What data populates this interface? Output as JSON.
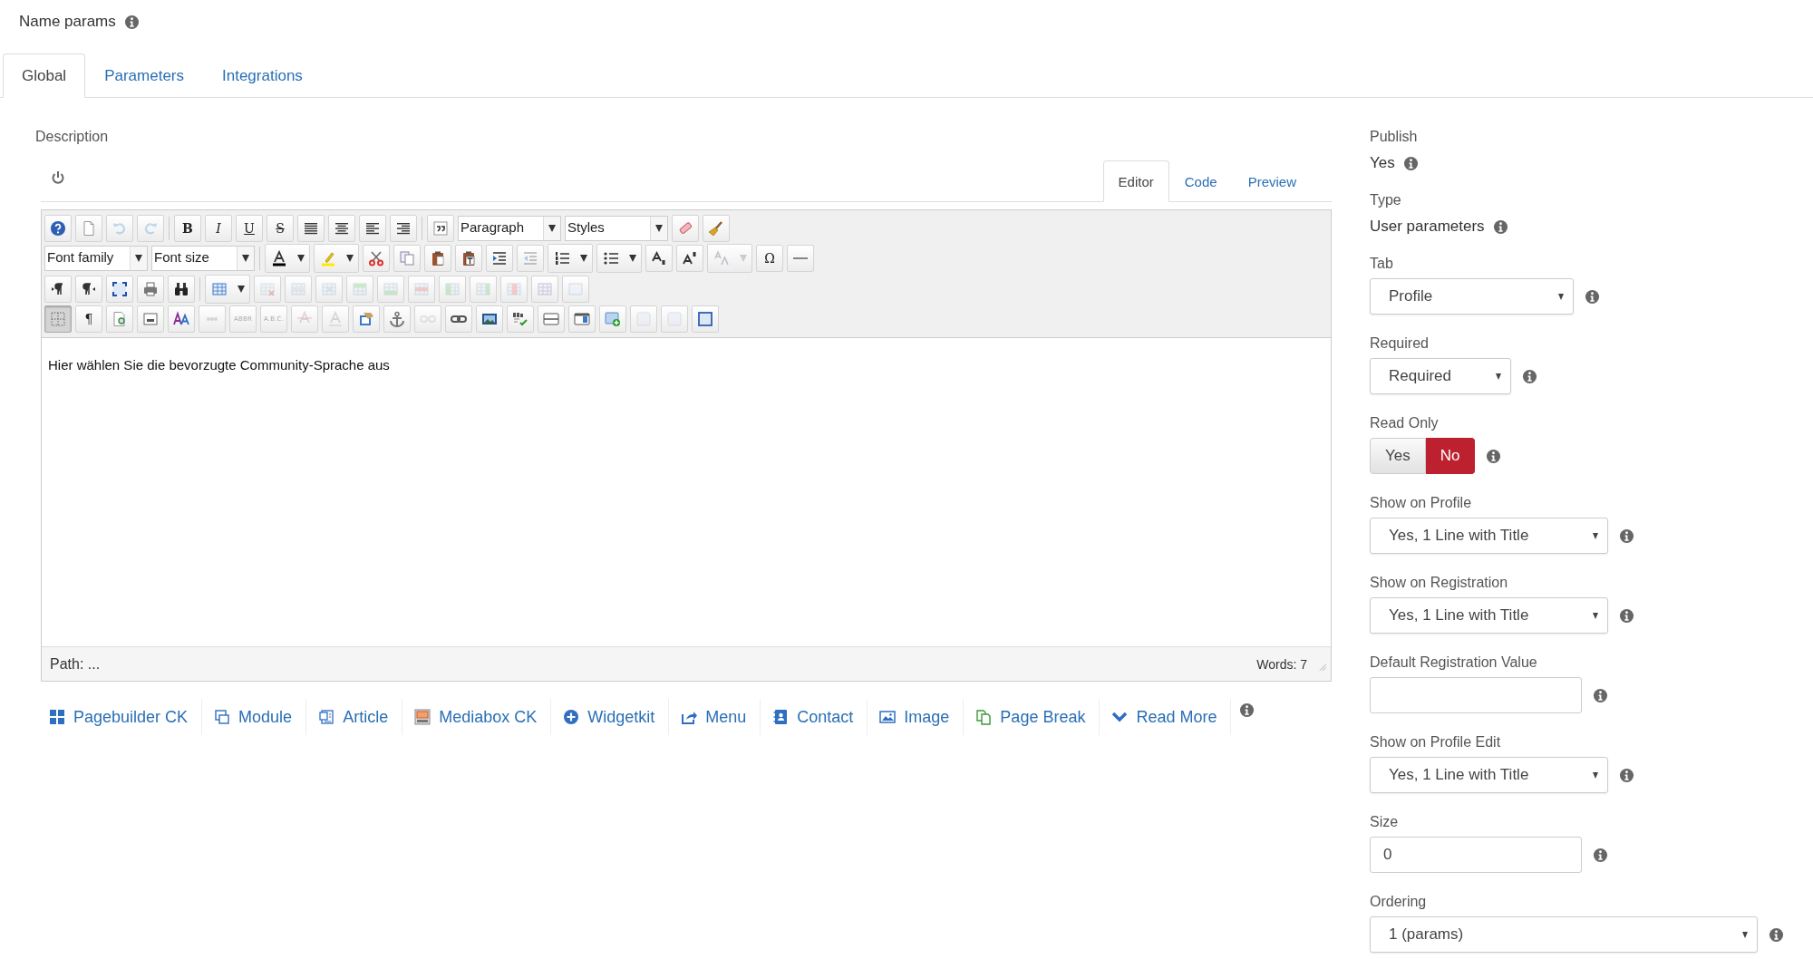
{
  "field_label": {
    "text": "Name params"
  },
  "tabs": [
    {
      "label": "Global",
      "selected": true
    },
    {
      "label": "Parameters",
      "selected": false
    },
    {
      "label": "Integrations",
      "selected": false
    }
  ],
  "description": {
    "label": "Description",
    "editor_tabs": [
      {
        "label": "Editor",
        "selected": true
      },
      {
        "label": "Code",
        "selected": false
      },
      {
        "label": "Preview",
        "selected": false
      }
    ],
    "toolbar": [
      [
        [
          {
            "kind": "icon",
            "disabled": false,
            "pressed": false
          },
          {
            "kind": "icon",
            "disabled": false,
            "pressed": false
          },
          {
            "kind": "icon",
            "disabled": true,
            "pressed": false
          },
          {
            "kind": "icon",
            "disabled": true,
            "pressed": false
          }
        ],
        [
          {
            "kind": "glyph",
            "text": "B",
            "disabled": false,
            "pressed": false
          },
          {
            "kind": "glyph",
            "text": "I",
            "disabled": false,
            "pressed": false
          },
          {
            "kind": "glyph",
            "text": "U",
            "disabled": false,
            "pressed": false
          },
          {
            "kind": "glyph",
            "text": "S",
            "disabled": false,
            "pressed": false
          },
          {
            "kind": "icon",
            "disabled": false,
            "pressed": false
          },
          {
            "kind": "icon",
            "disabled": false,
            "pressed": false
          },
          {
            "kind": "icon",
            "disabled": false,
            "pressed": false
          },
          {
            "kind": "icon",
            "disabled": false,
            "pressed": false
          }
        ],
        [
          {
            "kind": "icon",
            "disabled": false,
            "pressed": false
          },
          {
            "kind": "select",
            "text": "Paragraph",
            "disabled": false,
            "pressed": false
          },
          {
            "kind": "select",
            "text": "Styles",
            "disabled": false,
            "pressed": false
          },
          {
            "kind": "icon",
            "disabled": false,
            "pressed": false
          },
          {
            "kind": "icon",
            "disabled": false,
            "pressed": false
          }
        ]
      ],
      [
        [
          {
            "kind": "select",
            "text": "Font family",
            "disabled": false,
            "pressed": false
          },
          {
            "kind": "select",
            "text": "Font size",
            "disabled": false,
            "pressed": false
          }
        ],
        [
          {
            "kind": "split",
            "disabled": false,
            "pressed": false
          },
          {
            "kind": "split",
            "disabled": false,
            "pressed": false
          },
          {
            "kind": "icon",
            "disabled": false,
            "pressed": false
          },
          {
            "kind": "icon",
            "disabled": false,
            "pressed": false
          },
          {
            "kind": "icon",
            "disabled": false,
            "pressed": false
          },
          {
            "kind": "icon",
            "disabled": false,
            "pressed": false
          },
          {
            "kind": "icon",
            "disabled": false,
            "pressed": false
          },
          {
            "kind": "icon",
            "disabled": true,
            "pressed": false
          },
          {
            "kind": "split",
            "disabled": false,
            "pressed": false
          },
          {
            "kind": "split",
            "disabled": false,
            "pressed": false
          },
          {
            "kind": "icon",
            "disabled": false,
            "pressed": false
          },
          {
            "kind": "icon",
            "disabled": false,
            "pressed": false
          },
          {
            "kind": "split",
            "disabled": true,
            "pressed": false
          },
          {
            "kind": "glyph",
            "text": "Ω",
            "disabled": false,
            "pressed": false
          },
          {
            "kind": "icon",
            "disabled": false,
            "pressed": false
          }
        ]
      ],
      [
        [
          {
            "kind": "icon",
            "disabled": false,
            "pressed": false
          },
          {
            "kind": "icon",
            "disabled": false,
            "pressed": false
          },
          {
            "kind": "icon",
            "disabled": false,
            "pressed": false
          },
          {
            "kind": "icon",
            "disabled": false,
            "pressed": false
          },
          {
            "kind": "icon",
            "disabled": false,
            "pressed": false
          }
        ],
        [
          {
            "kind": "split",
            "disabled": false,
            "pressed": false
          },
          {
            "kind": "icon",
            "disabled": true,
            "pressed": false
          },
          {
            "kind": "icon",
            "disabled": true,
            "pressed": false
          },
          {
            "kind": "icon",
            "disabled": true,
            "pressed": false
          },
          {
            "kind": "icon",
            "disabled": true,
            "pressed": false
          },
          {
            "kind": "icon",
            "disabled": true,
            "pressed": false
          },
          {
            "kind": "icon",
            "disabled": true,
            "pressed": false
          },
          {
            "kind": "icon",
            "disabled": true,
            "pressed": false
          },
          {
            "kind": "icon",
            "disabled": true,
            "pressed": false
          },
          {
            "kind": "icon",
            "disabled": true,
            "pressed": false
          },
          {
            "kind": "icon",
            "disabled": true,
            "pressed": false
          },
          {
            "kind": "icon",
            "disabled": true,
            "pressed": false
          }
        ]
      ],
      [
        [
          {
            "kind": "icon",
            "disabled": false,
            "pressed": true
          },
          {
            "kind": "glyph",
            "text": "¶",
            "disabled": false,
            "pressed": false
          },
          {
            "kind": "icon",
            "disabled": false,
            "pressed": false
          },
          {
            "kind": "icon",
            "disabled": false,
            "pressed": false
          },
          {
            "kind": "icon",
            "disabled": false,
            "pressed": false
          },
          {
            "kind": "icon",
            "disabled": true,
            "pressed": false
          },
          {
            "kind": "glyph",
            "text": "ABBR",
            "disabled": true,
            "pressed": false
          },
          {
            "kind": "glyph",
            "text": "A.B.C.",
            "disabled": true,
            "pressed": false
          },
          {
            "kind": "icon",
            "disabled": true,
            "pressed": false
          },
          {
            "kind": "icon",
            "disabled": true,
            "pressed": false
          },
          {
            "kind": "icon",
            "disabled": false,
            "pressed": false
          },
          {
            "kind": "icon",
            "disabled": false,
            "pressed": false
          },
          {
            "kind": "icon",
            "disabled": true,
            "pressed": false
          },
          {
            "kind": "icon",
            "disabled": false,
            "pressed": false
          },
          {
            "kind": "icon",
            "disabled": false,
            "pressed": false
          },
          {
            "kind": "icon",
            "disabled": false,
            "pressed": false
          },
          {
            "kind": "icon",
            "disabled": false,
            "pressed": false
          },
          {
            "kind": "icon",
            "disabled": false,
            "pressed": false
          },
          {
            "kind": "icon",
            "disabled": false,
            "pressed": false
          },
          {
            "kind": "icon",
            "disabled": true,
            "pressed": false
          },
          {
            "kind": "icon",
            "disabled": true,
            "pressed": false
          },
          {
            "kind": "icon",
            "disabled": false,
            "pressed": false
          }
        ]
      ]
    ],
    "content": "Hier wählen Sie die bevorzugte Community-Sprache aus",
    "path": "Path: ...",
    "word_count": "Words: 7",
    "buttons": [
      {
        "label": "Pagebuilder CK"
      },
      {
        "label": "Module"
      },
      {
        "label": "Article"
      },
      {
        "label": "Mediabox CK"
      },
      {
        "label": "Widgetkit"
      },
      {
        "label": "Menu"
      },
      {
        "label": "Contact"
      },
      {
        "label": "Image"
      },
      {
        "label": "Page Break"
      },
      {
        "label": "Read More"
      }
    ]
  },
  "fields": [
    {
      "kind": "static",
      "label": "Publish",
      "value": "Yes"
    },
    {
      "kind": "static",
      "label": "Type",
      "value": "User parameters"
    },
    {
      "kind": "select",
      "label": "Tab",
      "value": "Profile"
    },
    {
      "kind": "select",
      "label": "Required",
      "value": "Required"
    },
    {
      "kind": "toggle",
      "label": "Read Only",
      "options": [
        {
          "label": "Yes",
          "selected": false
        },
        {
          "label": "No",
          "selected": true
        }
      ]
    },
    {
      "kind": "select",
      "label": "Show on Profile",
      "value": "Yes, 1 Line with Title"
    },
    {
      "kind": "select",
      "label": "Show on Registration",
      "value": "Yes, 1 Line with Title"
    },
    {
      "kind": "input",
      "label": "Default Registration Value"
    },
    {
      "kind": "select",
      "label": "Show on Profile Edit",
      "value": "Yes, 1 Line with Title"
    },
    {
      "kind": "input",
      "label": "Size",
      "value": "0"
    },
    {
      "kind": "select",
      "label": "Ordering",
      "value": "1 (params)"
    }
  ]
}
